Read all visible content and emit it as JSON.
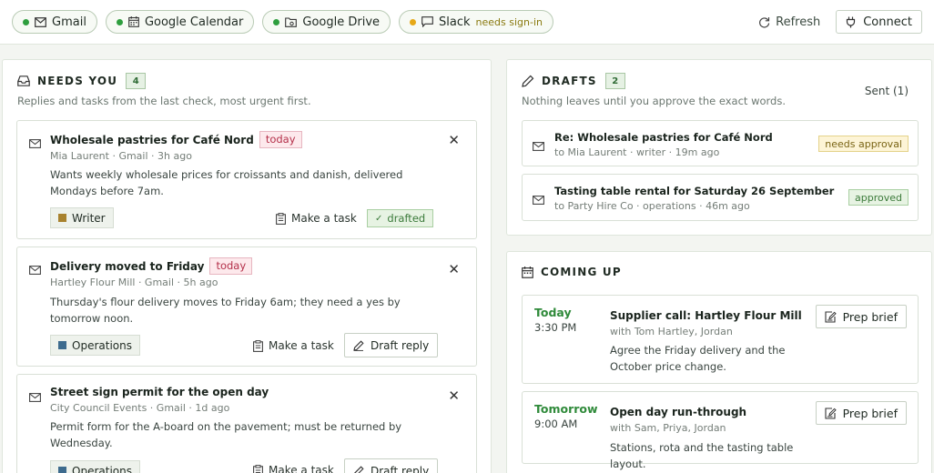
{
  "integrations": [
    {
      "name": "Gmail",
      "status_color": "#2e9e3e",
      "icon": "envelope-icon",
      "note": ""
    },
    {
      "name": "Google Calendar",
      "status_color": "#2e9e3e",
      "icon": "calendar-icon",
      "note": ""
    },
    {
      "name": "Google Drive",
      "status_color": "#2e9e3e",
      "icon": "folder-icon",
      "note": ""
    },
    {
      "name": "Slack",
      "status_color": "#e6a817",
      "icon": "chat-icon",
      "note": "needs sign-in"
    }
  ],
  "toolbar": {
    "refresh_label": "Refresh",
    "connect_label": "Connect"
  },
  "needs_you": {
    "title": "NEEDS YOU",
    "count": "4",
    "subtitle": "Replies and tasks from the last check, most urgent first.",
    "items": [
      {
        "title": "Wholesale pastries for Café Nord",
        "badge": "today",
        "meta": "Mia Laurent · Gmail · 3h ago",
        "desc": "Wants weekly wholesale prices for croissants and danish, delivered Mondays before 7am.",
        "tag": "Writer",
        "tag_color": "#a8822e",
        "task_label": "Make a task",
        "action_label": "drafted"
      },
      {
        "title": "Delivery moved to Friday",
        "badge": "today",
        "meta": "Hartley Flour Mill · Gmail · 5h ago",
        "desc": "Thursday's flour delivery moves to Friday 6am; they need a yes by tomorrow noon.",
        "tag": "Operations",
        "tag_color": "#3d6b8e",
        "task_label": "Make a task",
        "action_label": "Draft reply"
      },
      {
        "title": "Street sign permit for the open day",
        "badge": "",
        "meta": "City Council Events · Gmail · 1d ago",
        "desc": "Permit form for the A-board on the pavement; must be returned by Wednesday.",
        "tag": "Operations",
        "tag_color": "#3d6b8e",
        "task_label": "Make a task",
        "action_label": "Draft reply"
      }
    ]
  },
  "drafts": {
    "title": "DRAFTS",
    "count": "2",
    "subtitle": "Nothing leaves until you approve the exact words.",
    "sent_label": "Sent (1)",
    "items": [
      {
        "title": "Re: Wholesale pastries for Café Nord",
        "meta": "to Mia Laurent · writer · 19m ago",
        "status": "needs approval"
      },
      {
        "title": "Tasting table rental for Saturday 26 September",
        "meta": "to Party Hire Co · operations · 46m ago",
        "status": "approved"
      }
    ]
  },
  "coming_up": {
    "title": "COMING UP",
    "items": [
      {
        "day": "Today",
        "time": "3:30 PM",
        "title": "Supplier call: Hartley Flour Mill",
        "meta": "with Tom Hartley, Jordan",
        "desc": "Agree the Friday delivery and the October price change.",
        "button": "Prep brief"
      },
      {
        "day": "Tomorrow",
        "time": "9:00 AM",
        "title": "Open day run-through",
        "meta": "with Sam, Priya, Jordan",
        "desc": "Stations, rota and the tasting table layout.",
        "button": "Prep brief"
      }
    ]
  }
}
